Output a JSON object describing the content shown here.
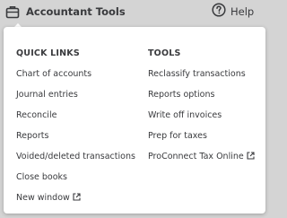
{
  "topbar": {
    "tools_label": "Accountant Tools",
    "tools_icon": "briefcase-icon",
    "help_label": "Help",
    "help_icon": "question-circle-icon"
  },
  "menu": {
    "quick_links": {
      "header": "QUICK LINKS",
      "items": [
        {
          "label": "Chart of accounts"
        },
        {
          "label": "Journal entries"
        },
        {
          "label": "Reconcile"
        },
        {
          "label": "Reports"
        },
        {
          "label": "Voided/deleted transactions"
        },
        {
          "label": "Close books"
        },
        {
          "label": "New window",
          "icon": "external-link-icon"
        }
      ]
    },
    "tools": {
      "header": "TOOLS",
      "items": [
        {
          "label": "Reclassify transactions"
        },
        {
          "label": "Reports options"
        },
        {
          "label": "Write off invoices"
        },
        {
          "label": "Prep for taxes"
        },
        {
          "label": "ProConnect Tax Online",
          "icon": "external-link-icon"
        }
      ]
    }
  },
  "colors": {
    "background": "#d4d4d4",
    "menu_bg": "#ffffff",
    "text": "#393a3d"
  }
}
